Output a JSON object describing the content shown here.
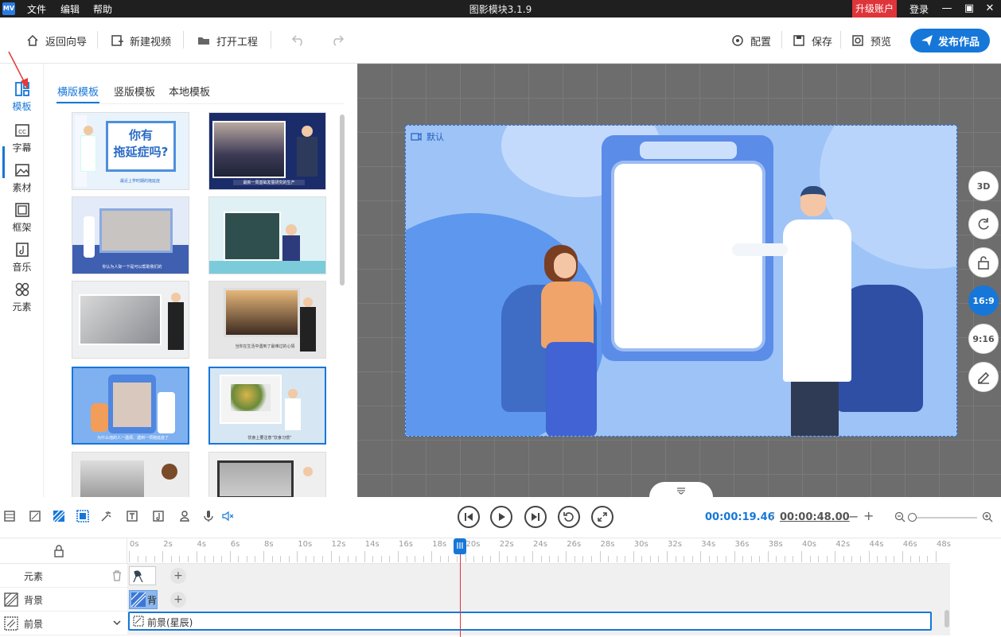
{
  "titlebar": {
    "logo": "MV",
    "menu": [
      "文件",
      "编辑",
      "帮助"
    ],
    "title": "图影模块3.1.9",
    "upgrade": "升级账户",
    "login": "登录"
  },
  "toolbar": {
    "back": "返回向导",
    "new_video": "新建视频",
    "open_project": "打开工程",
    "config": "配置",
    "save": "保存",
    "preview": "预览",
    "publish": "发布作品"
  },
  "sidebar": {
    "items": [
      {
        "label": "模板",
        "icon": "template-icon"
      },
      {
        "label": "字幕",
        "icon": "subtitle-icon"
      },
      {
        "label": "素材",
        "icon": "image-icon"
      },
      {
        "label": "框架",
        "icon": "frame-icon"
      },
      {
        "label": "音乐",
        "icon": "music-icon"
      },
      {
        "label": "元素",
        "icon": "elements-icon"
      }
    ]
  },
  "template_panel": {
    "tabs": [
      "横版模板",
      "竖版模板",
      "本地模板"
    ],
    "thumbs": [
      {
        "title_line1": "你有",
        "title_line2": "拖延症吗?",
        "caption": "最近上学时期的拖延症"
      },
      {
        "caption": "最新一周基础发展研究的生产"
      },
      {
        "caption": "你认为人际一下是可以帮助我们的"
      },
      {
        "caption": ""
      },
      {
        "caption": ""
      },
      {
        "caption": "当你在生活中遇到了最难过的心情"
      },
      {
        "caption": "为什么他的人一遇烦、遇到一项拖延症了"
      },
      {
        "caption": "饮食上要注意“饮食习惯”"
      },
      {
        "caption": ""
      },
      {
        "caption": ""
      }
    ]
  },
  "canvas": {
    "stage_label": "默认",
    "side_buttons": [
      "3D",
      "rotate",
      "unlock",
      "16:9",
      "9:16",
      "edit"
    ]
  },
  "playback": {
    "current_time": "00:00:19.46",
    "separator": "/",
    "total_time": "00:00:48.00",
    "minus": "−",
    "plus": "+"
  },
  "timeline": {
    "ticks": [
      "0s",
      "2s",
      "4s",
      "6s",
      "8s",
      "10s",
      "12s",
      "14s",
      "16s",
      "18s",
      "20s",
      "22s",
      "24s",
      "26s",
      "28s",
      "30s",
      "32s",
      "34s",
      "36s",
      "38s",
      "40s",
      "42s",
      "44s",
      "46s",
      "48s"
    ],
    "rows": [
      {
        "label": "元素"
      },
      {
        "label": "背景",
        "clip": "背"
      },
      {
        "label": "前景",
        "clip": "前景(星辰)"
      }
    ]
  },
  "colors": {
    "accent": "#1677d9",
    "upgrade": "#e0343b",
    "playhead": "#e0343b"
  }
}
